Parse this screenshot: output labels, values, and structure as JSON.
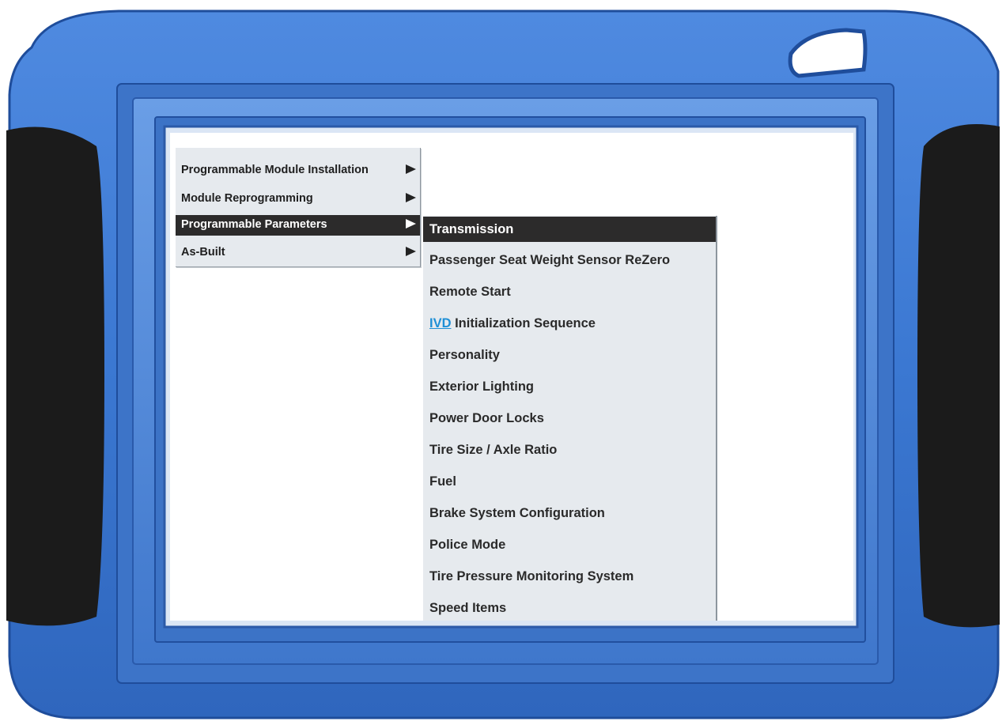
{
  "device": {
    "bezel_color": "#3e7ad4",
    "grip_color": "#1b1b1b"
  },
  "menu": {
    "items": [
      {
        "label": "Programmable Module Installation",
        "active": false
      },
      {
        "label": "Module Reprogramming",
        "active": false
      },
      {
        "label": "Programmable Parameters",
        "active": true
      },
      {
        "label": "As-Built",
        "active": false
      }
    ]
  },
  "submenu": {
    "items": [
      {
        "label": "Transmission",
        "active": true
      },
      {
        "label": "Passenger Seat Weight Sensor ReZero"
      },
      {
        "label": "Remote Start"
      },
      {
        "abbr": "IVD",
        "label": " Initialization Sequence"
      },
      {
        "label": "Personality"
      },
      {
        "label": "Exterior Lighting"
      },
      {
        "label": "Power Door Locks"
      },
      {
        "label": "Tire Size / Axle Ratio"
      },
      {
        "label": "Fuel"
      },
      {
        "label": "Brake System Configuration"
      },
      {
        "label": "Police Mode"
      },
      {
        "label": "Tire Pressure Monitoring System"
      },
      {
        "label": "Speed Items"
      }
    ]
  },
  "colors": {
    "highlight": "#2c2b2b",
    "menu_bg": "#e6eaee",
    "link": "#1e8fd6"
  }
}
